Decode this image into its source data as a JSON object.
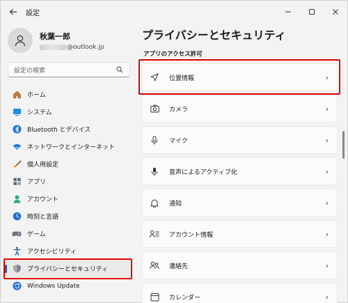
{
  "window": {
    "title": "設定",
    "back_icon": "arrow-left-icon"
  },
  "user": {
    "name": "秋葉一郎",
    "email_suffix": "@outlook.jp"
  },
  "search": {
    "placeholder": "設定の検索"
  },
  "sidebar": {
    "items": [
      {
        "label": "ホーム",
        "icon": "home-icon"
      },
      {
        "label": "システム",
        "icon": "system-icon"
      },
      {
        "label": "Bluetooth とデバイス",
        "icon": "bluetooth-icon"
      },
      {
        "label": "ネットワークとインターネット",
        "icon": "wifi-icon"
      },
      {
        "label": "個人用設定",
        "icon": "brush-icon"
      },
      {
        "label": "アプリ",
        "icon": "apps-icon"
      },
      {
        "label": "アカウント",
        "icon": "account-icon"
      },
      {
        "label": "時刻と言語",
        "icon": "time-language-icon"
      },
      {
        "label": "ゲーム",
        "icon": "gamepad-icon"
      },
      {
        "label": "アクセシビリティ",
        "icon": "accessibility-icon"
      },
      {
        "label": "プライバシーとセキュリティ",
        "icon": "shield-icon",
        "selected": true
      },
      {
        "label": "Windows Update",
        "icon": "update-icon"
      }
    ]
  },
  "main": {
    "title": "プライバシーとセキュリティ",
    "section": "アプリのアクセス許可",
    "rows": [
      {
        "label": "位置情報",
        "icon": "location-icon"
      },
      {
        "label": "カメラ",
        "icon": "camera-icon"
      },
      {
        "label": "マイク",
        "icon": "microphone-icon"
      },
      {
        "label": "音声によるアクティブ化",
        "icon": "voice-activation-icon"
      },
      {
        "label": "通知",
        "icon": "bell-icon"
      },
      {
        "label": "アカウント情報",
        "icon": "account-info-icon"
      },
      {
        "label": "連絡先",
        "icon": "contacts-icon"
      },
      {
        "label": "カレンダー",
        "icon": "calendar-icon"
      }
    ]
  },
  "colors": {
    "accent": "#0067c0",
    "highlight": "#e00000",
    "background": "#f3f3f3"
  }
}
